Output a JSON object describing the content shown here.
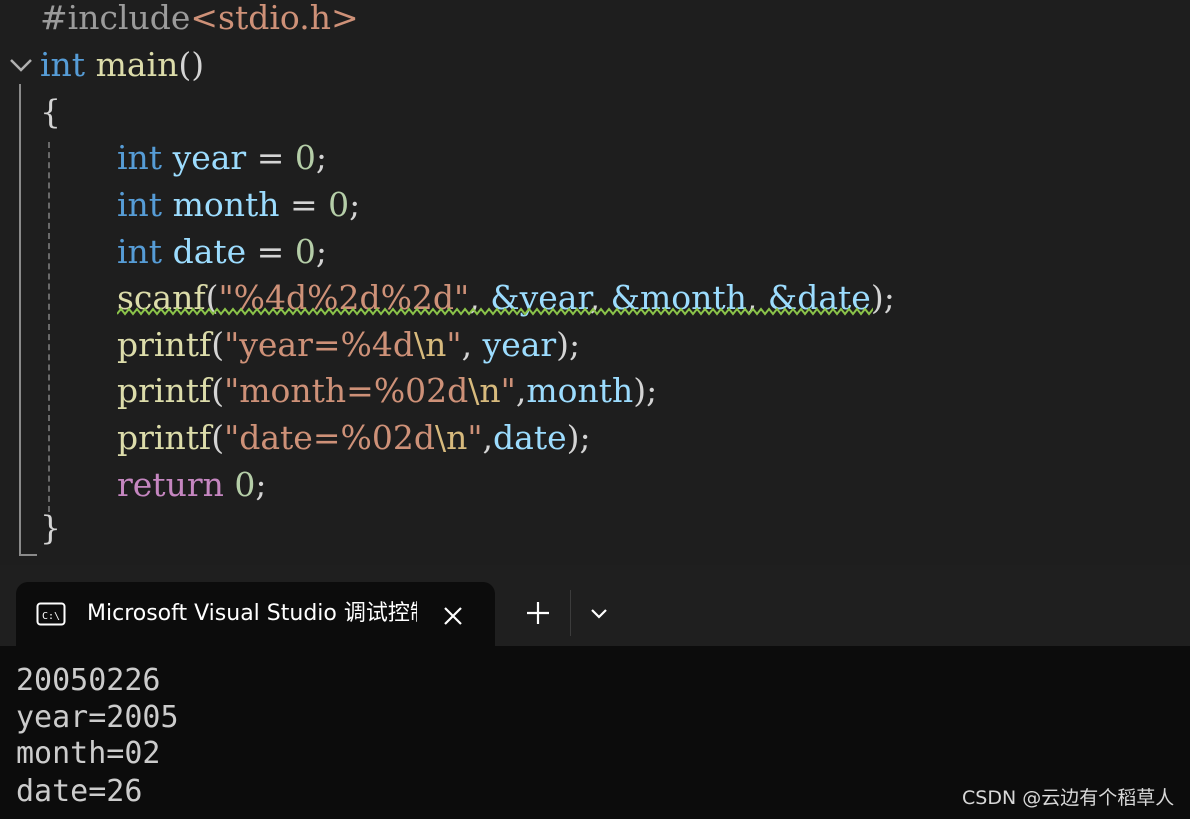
{
  "editor": {
    "include": {
      "directive": "#include",
      "header": "<stdio.h>"
    },
    "main_sig": {
      "kw": "int",
      "name": "main",
      "parens": "()"
    },
    "brace_open": "{",
    "decl_year": {
      "kw": "int",
      "name": "year",
      "op": " = ",
      "val": "0",
      "end": ";"
    },
    "decl_month": {
      "kw": "int",
      "name": "month",
      "op": " = ",
      "val": "0",
      "end": ";"
    },
    "decl_date": {
      "kw": "int",
      "name": "date",
      "op": " = ",
      "val": "0",
      "end": ";"
    },
    "scanf_line": {
      "fn": "scanf",
      "open": "(",
      "fmt": "\"%4d%2d%2d\"",
      "arg1": "&year",
      "arg2": "&month",
      "arg3": "&date",
      "sep": ", ",
      "close": ");"
    },
    "printf_year": {
      "fn": "printf",
      "open": "(",
      "fmt": "\"year=%4d",
      "esc": "\\n",
      "q": "\"",
      "sep": ", ",
      "arg": "year",
      "close": ");"
    },
    "printf_month": {
      "fn": "printf",
      "open": "(",
      "fmt": "\"month=%02d",
      "esc": "\\n",
      "q": "\"",
      "sep": ",",
      "arg": "month",
      "close": ");"
    },
    "printf_date": {
      "fn": "printf",
      "open": "(",
      "fmt": "\"date=%02d",
      "esc": "\\n",
      "q": "\"",
      "sep": ",",
      "arg": "date",
      "close": ");"
    },
    "return_line": {
      "kw": "return",
      "val": "0",
      "end": ";"
    },
    "brace_close": "}"
  },
  "terminal": {
    "tab_title": "Microsoft Visual Studio 调试控制台",
    "output": [
      "20050226",
      "year=2005",
      "month=02",
      "date=26"
    ]
  },
  "watermark": "CSDN @云边有个稻草人",
  "colors": {
    "keyword": "#569cd6",
    "function": "#dcdcaa",
    "variable": "#9cdcfe",
    "string": "#ce9178",
    "number": "#b5cea8",
    "control": "#c586c0",
    "squiggle": "#8bc34a"
  },
  "icons": [
    "chevron-down-icon",
    "console-icon",
    "close-icon",
    "plus-icon",
    "chevron-down-icon"
  ]
}
